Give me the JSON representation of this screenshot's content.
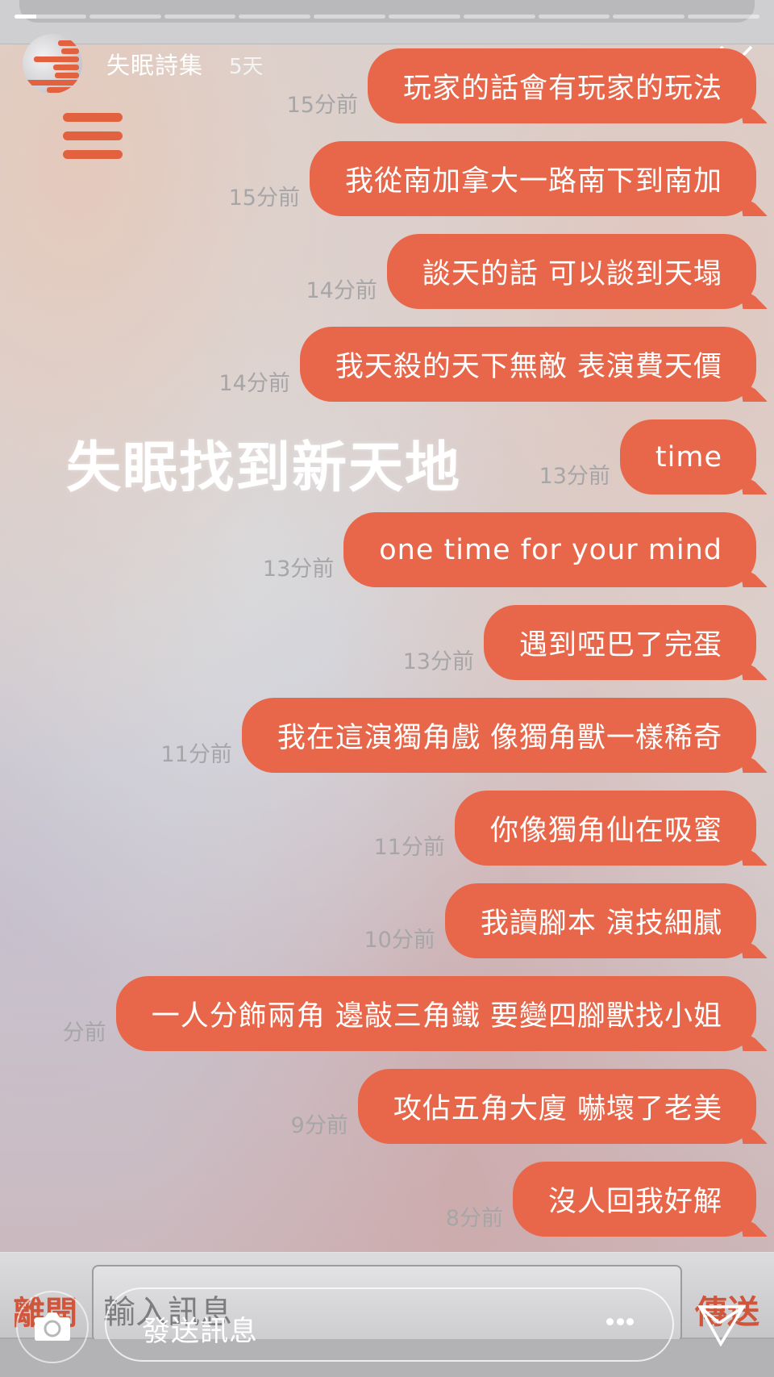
{
  "story": {
    "progress": {
      "segment_count": 10,
      "current_segment": 1,
      "current_segment_progress": 0.3
    },
    "header": {
      "author": "失眠詩集",
      "age": "5天"
    },
    "overlay_title": "失眠找到新天地",
    "messages": [
      {
        "text": "玩家的話會有玩家的玩法",
        "time": "15分前"
      },
      {
        "text": "我從南加拿大一路南下到南加",
        "time": "15分前"
      },
      {
        "text": "談天的話 可以談到天塌",
        "time": "14分前"
      },
      {
        "text": "我天殺的天下無敵 表演費天價",
        "time": "14分前"
      },
      {
        "text": "time",
        "time": "13分前"
      },
      {
        "text": "one time for your mind",
        "time": "13分前"
      },
      {
        "text": "遇到啞巴了完蛋",
        "time": "13分前"
      },
      {
        "text": "我在這演獨角戲 像獨角獸一樣稀奇",
        "time": "11分前"
      },
      {
        "text": "你像獨角仙在吸蜜",
        "time": "11分前"
      },
      {
        "text": "我讀腳本 演技細膩",
        "time": "10分前"
      },
      {
        "text": "一人分飾兩角 邊敲三角鐵 要變四腳獸找小姐",
        "time": "分前"
      },
      {
        "text": "攻佔五角大廈 嚇壞了老美",
        "time": "9分前"
      },
      {
        "text": "沒人回我好解",
        "time": "8分前"
      }
    ],
    "chat_input": {
      "leave_label": "離開",
      "placeholder": "輸入訊息",
      "send_label": "傳送"
    }
  },
  "reply_bar": {
    "placeholder": "發送訊息"
  },
  "colors": {
    "bubble": "#e8674a",
    "accent_text": "#d0553a",
    "timestamp": "#a6a6a8"
  }
}
